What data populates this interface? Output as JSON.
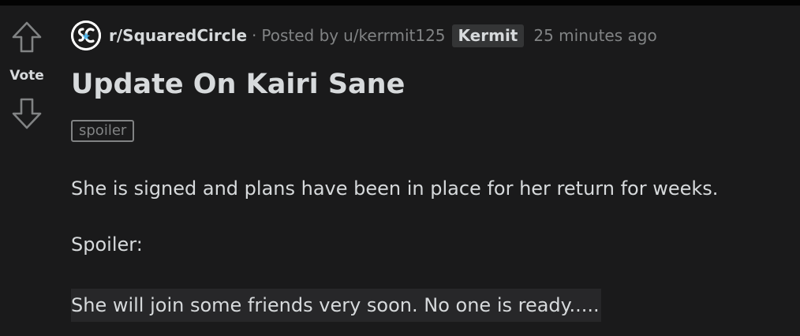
{
  "vote": {
    "label": "Vote",
    "up_icon": "arrow-up-outline-icon",
    "down_icon": "arrow-down-outline-icon"
  },
  "meta": {
    "subreddit_icon": "subreddit-logo-icon",
    "subreddit": "r/SquaredCircle",
    "separator": "·",
    "posted_by": "Posted by",
    "author": "u/kerrmit125",
    "flair": "Kermit",
    "time": "25 minutes ago"
  },
  "post": {
    "title": "Update On Kairi Sane",
    "tag": "spoiler",
    "paragraph_1": "She is signed and plans have been in place for her return for weeks.",
    "paragraph_2": "Spoiler:",
    "spoiler_text": "She will join some friends very soon. No one is ready....."
  },
  "colors": {
    "page_bg": "#030303",
    "card_bg": "#1a1a1b",
    "text_primary": "#d7dadc",
    "text_muted": "#818384",
    "flair_bg": "#343536",
    "spoiler_bg": "#272729"
  }
}
